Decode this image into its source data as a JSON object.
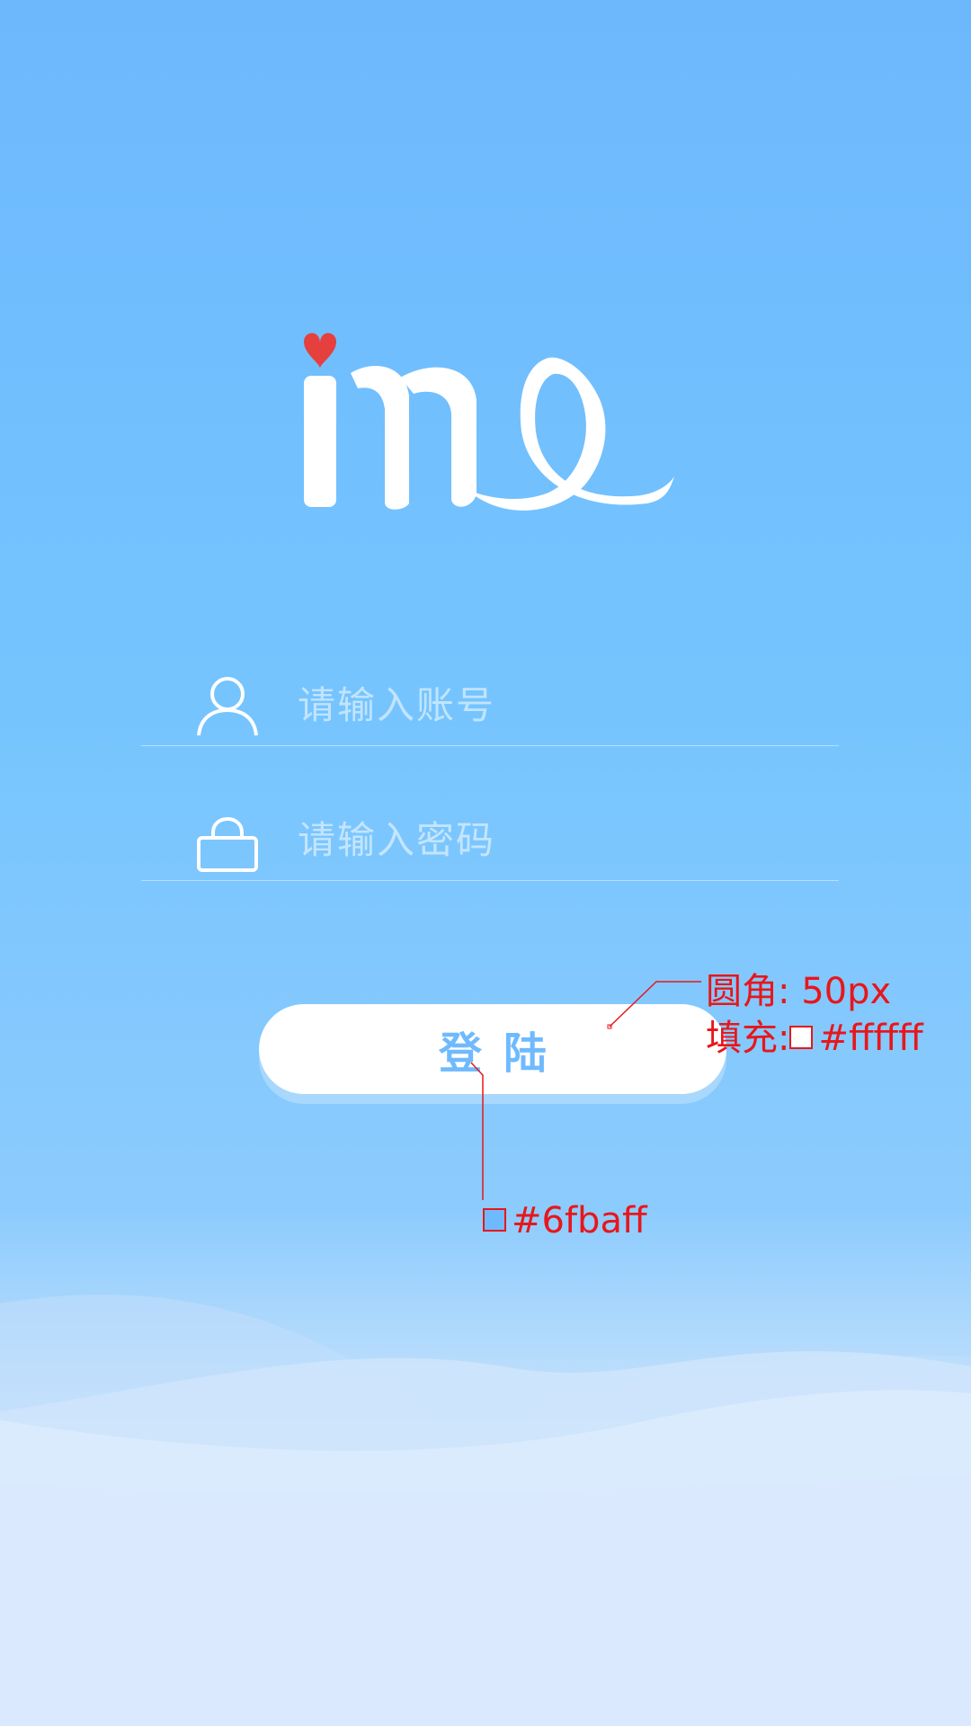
{
  "login": {
    "username_placeholder": "请输入账号",
    "password_placeholder": "请输入密码",
    "button_label": "登陆"
  },
  "annotations": {
    "radius_label": "圆角: 50px",
    "fill_label": "填充:",
    "fill_value": "#ffffff",
    "text_color_value": "#6fbaff"
  },
  "colors": {
    "background_top": "#6db8fd",
    "button_fill": "#ffffff",
    "button_text": "#6fbaff",
    "heart": "#e5403e",
    "annotation": "#e8161b"
  },
  "icons": {
    "user": "user-icon",
    "lock": "lock-icon",
    "heart": "heart-icon"
  }
}
